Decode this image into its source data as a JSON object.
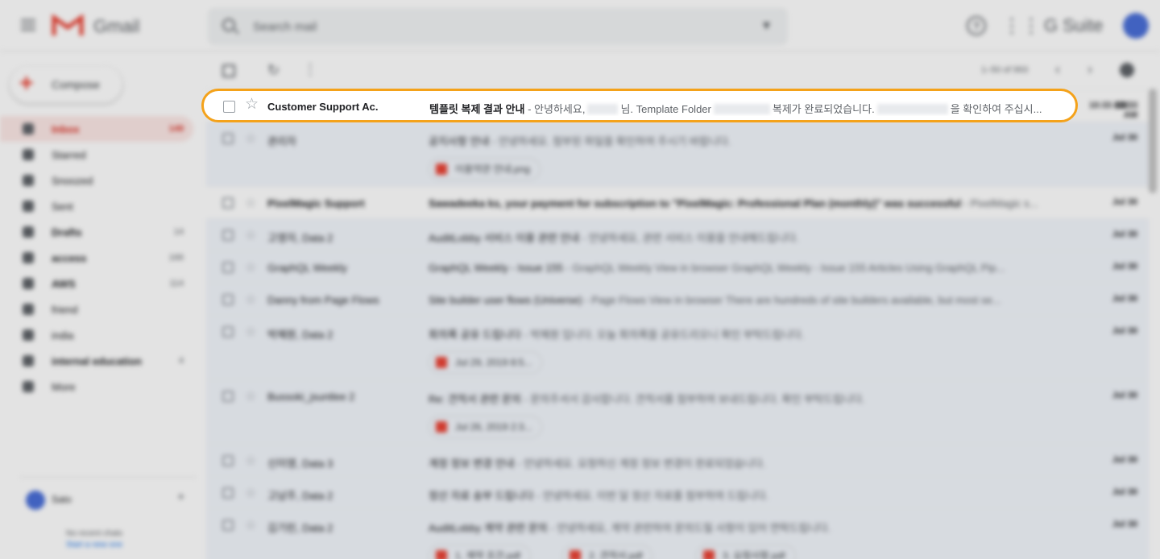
{
  "app": {
    "logo_text": "Gmail",
    "search_placeholder": "Search mail",
    "gsuite_label": "G Suite",
    "compose_label": "Compose"
  },
  "sidebar": {
    "items": [
      {
        "label": "Inbox",
        "count": "149",
        "active": true
      },
      {
        "label": "Starred",
        "count": ""
      },
      {
        "label": "Snoozed",
        "count": ""
      },
      {
        "label": "Sent",
        "count": ""
      },
      {
        "label": "Drafts",
        "count": "14",
        "bold": true
      },
      {
        "label": "access",
        "count": "166",
        "bold": true
      },
      {
        "label": "AWS",
        "count": "114",
        "bold": true
      },
      {
        "label": "friend",
        "count": ""
      },
      {
        "label": "india",
        "count": ""
      },
      {
        "label": "internal education",
        "count": "4",
        "bold": true
      },
      {
        "label": "More",
        "count": ""
      }
    ],
    "hangouts": {
      "user": "Sato",
      "note": "No recent chats",
      "link": "Start a new one"
    }
  },
  "toolbar": {
    "range": "1–50 of 993"
  },
  "focused_email": {
    "sender": "Customer Support Ac.",
    "subject": "템플릿 복제 결과 안내",
    "dash": " - ",
    "snippet_1": "안녕하세요,",
    "snippet_2": "님. Template Folder",
    "snippet_3": "복제가 완료되었습니다.",
    "snippet_4": "을 확인하여 주십시..."
  },
  "emails": [
    {
      "sender": "Customer Support Ac.",
      "subject": "템플릿 복제 결과 안내",
      "snippet": "",
      "date": "10:33 AM",
      "unread": true,
      "tall": false
    },
    {
      "sender": "관리자",
      "subject": "공지사항 안내",
      "snippet": " - 안녕하세요. 첨부된 파일을 확인하여 주시기 바랍니다.",
      "date": "Jul 30",
      "unread": false,
      "tall": true,
      "attachment": "이용약관 안내.png"
    },
    {
      "sender": "PixelMagic Support",
      "subject": "Sawadeeka ks, your payment for subscription to \"PixelMagic: Professional Plan (monthly)\" was successful",
      "snippet": " - PixelMagic s...",
      "date": "Jul 30",
      "unread": true,
      "tall": false
    },
    {
      "sender": "고영자, Data 2",
      "subject": "AuditLobby 서비스 이용 관련 안내",
      "snippet": " - 안녕하세요, 관련 서비스 이용을 안내해드립니다.",
      "date": "Jul 30",
      "unread": false,
      "tall": false
    },
    {
      "sender": "GraphQL Weekly",
      "subject": "GraphQL Weekly - Issue 155",
      "snippet": " - GraphQL Weekly View in browser GraphQL Weekly - Issue 155 Articles Using GraphQL Pip...",
      "date": "Jul 30",
      "unread": false,
      "tall": false
    },
    {
      "sender": "Danny from Page Flows",
      "subject": "Site builder user flows (Universe)",
      "snippet": " - Page Flows View in browser There are hundreds of site builders available, but most se...",
      "date": "Jul 30",
      "unread": false,
      "tall": false
    },
    {
      "sender": "박혜원, Data 2",
      "subject": "회의록 공유 드립니다",
      "snippet": " - 박혜원 입니다. 오늘 회의록을 공유드리오니 확인 부탁드립니다.",
      "date": "Jul 30",
      "unread": false,
      "tall": true,
      "attachment": "Jul 29, 2019 8:5..."
    },
    {
      "sender": "Bussoki_jsuntlee 2",
      "subject": "Re: 견적서 관련 문의",
      "snippet": " - 문의주셔서 감사합니다. 견적서를 첨부하여 보내드립니다. 확인 부탁드립니다.",
      "date": "Jul 30",
      "unread": false,
      "tall": true,
      "attachment": "Jul 26, 2019 2:3..."
    },
    {
      "sender": "신미영, Data 3",
      "subject": "계정 정보 변경 안내",
      "snippet": " - 안녕하세요. 요청하신 계정 정보 변경이 완료되었습니다.",
      "date": "Jul 30",
      "unread": false,
      "tall": false
    },
    {
      "sender": "고남주, Data 2",
      "subject": "정산 자료 송부 드립니다",
      "snippet": " - 안녕하세요. 이번 달 정산 자료를 첨부하여 드립니다.",
      "date": "Jul 30",
      "unread": false,
      "tall": false
    },
    {
      "sender": "김기린, Data 2",
      "subject": "AuditLobby 계약 관련 문의",
      "snippet": " - 안녕하세요, 계약 관련하여 문의드릴 사항이 있어 연락드립니다.",
      "date": "Jul 30",
      "unread": false,
      "tall": true,
      "attachments": [
        "1. 계약 조건.pdf",
        "2. 견적서.pdf",
        "3. 요청사항.pdf"
      ]
    }
  ]
}
